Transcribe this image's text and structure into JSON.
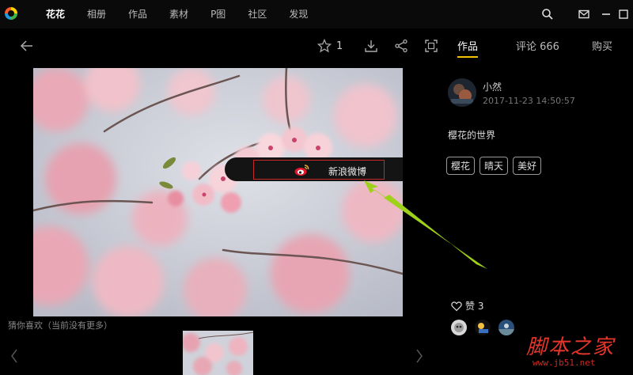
{
  "nav": {
    "items": [
      "花花",
      "相册",
      "作品",
      "素材",
      "P图",
      "社区",
      "发现"
    ],
    "active_index": 0
  },
  "toolbar": {
    "star_count": "1"
  },
  "right_tabs": {
    "works": "作品",
    "comments": "评论 666",
    "buy": "购买"
  },
  "share": {
    "label": "新浪微博"
  },
  "author": {
    "name": "小然",
    "time": "2017-11-23 14:50:57"
  },
  "caption": "樱花的世界",
  "tags": [
    "樱花",
    "晴天",
    "美好"
  ],
  "likes": {
    "label": "赞 3"
  },
  "related": {
    "title": "猜你喜欢（当前没有更多）"
  },
  "watermark": {
    "title": "脚本之家",
    "url": "www.jb51.net"
  },
  "colors": {
    "accent": "#f2c100",
    "share_border": "#c42a2a",
    "arrow": "#9ed11a",
    "watermark": "#e6352b"
  },
  "icons": [
    "app-logo-icon",
    "search-icon",
    "mail-icon",
    "minimize-icon",
    "maximize-icon",
    "back-arrow-icon",
    "star-icon",
    "download-icon",
    "share-icon",
    "fullscreen-icon",
    "weibo-icon",
    "heart-icon",
    "chevron-left-icon",
    "chevron-right-icon"
  ]
}
